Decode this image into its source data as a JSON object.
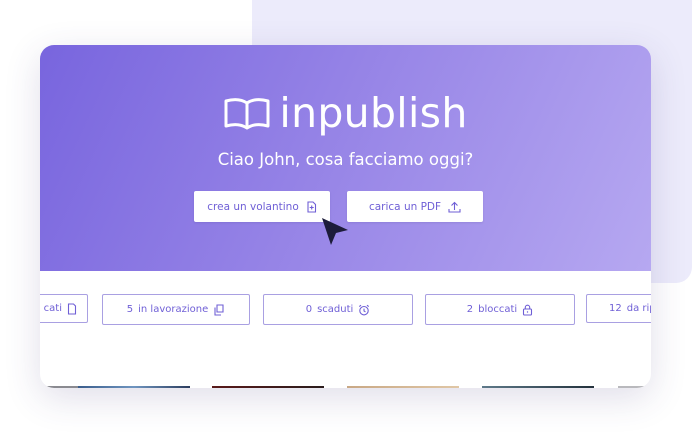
{
  "brand": {
    "name": "inpublish",
    "logo_icon": "open-book-icon",
    "gradient_start": "#7865de",
    "gradient_end": "#b6a8f1",
    "accent": "#6f5fd6"
  },
  "hero": {
    "greeting": "Ciao John, cosa facciamo oggi?",
    "buttons": {
      "create": {
        "label": "crea un volantino",
        "icon": "new-document-icon"
      },
      "upload": {
        "label": "carica un PDF",
        "icon": "upload-icon"
      }
    }
  },
  "statuses": [
    {
      "count": "",
      "label": "cati",
      "icon": "document-icon"
    },
    {
      "count": "5",
      "label": "in lavorazione",
      "icon": "copy-documents-icon"
    },
    {
      "count": "0",
      "label": "scaduti",
      "icon": "alarm-clock-icon"
    },
    {
      "count": "2",
      "label": "bloccati",
      "icon": "lock-icon"
    },
    {
      "count": "12",
      "label": "da rip",
      "icon": ""
    }
  ]
}
